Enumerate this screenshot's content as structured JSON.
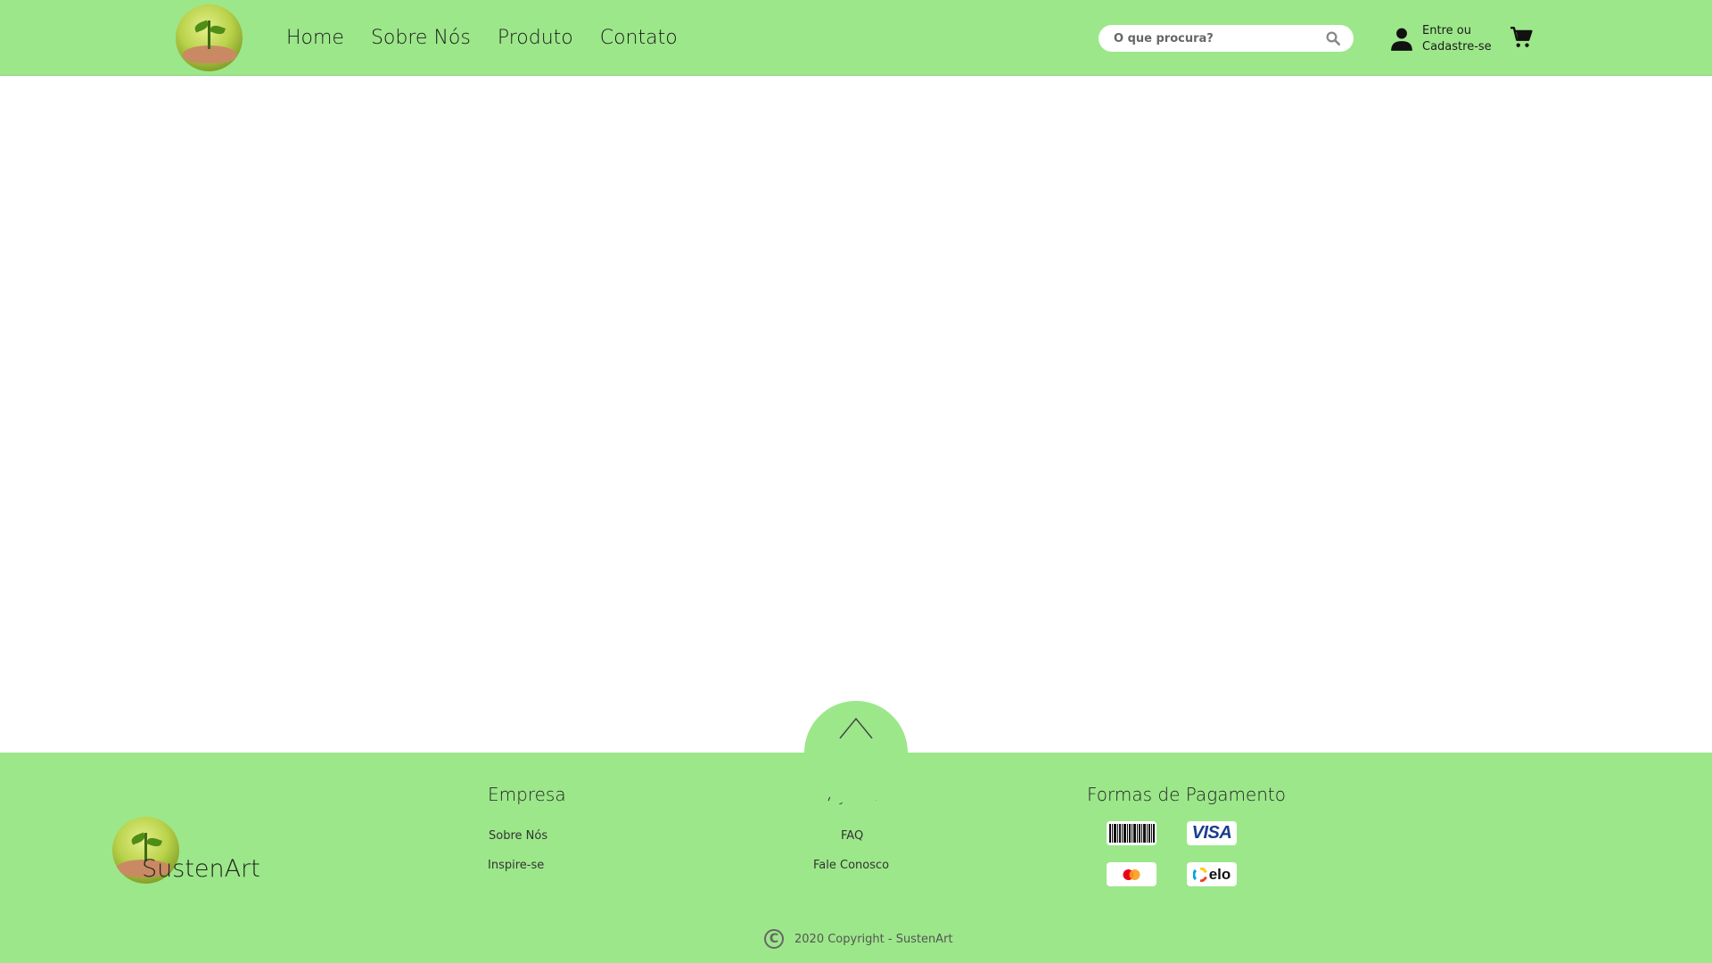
{
  "header": {
    "nav": [
      "Home",
      "Sobre Nós",
      "Produto",
      "Contato"
    ],
    "search_placeholder": "O que procura?",
    "user_line1": "Entre ou",
    "user_line2": "Cadastre-se"
  },
  "footer": {
    "brand": "SustenArt",
    "empresa": {
      "title": "Empresa",
      "links": [
        "Sobre Nós",
        "Inspire-se"
      ]
    },
    "ajuda": {
      "title": "Ajuda",
      "links": [
        "FAQ",
        "Fale Conosco"
      ]
    },
    "pagamento": {
      "title": "Formas de Pagamento",
      "methods": [
        "boleto-icon",
        "visa-icon",
        "mastercard-icon",
        "elo-icon"
      ],
      "visa": "VISA",
      "elo": "elo"
    },
    "copyright": "2020 Copyright - SustenArt",
    "copyright_symbol": "C"
  },
  "colors": {
    "primary_green": "#9ce78a"
  }
}
